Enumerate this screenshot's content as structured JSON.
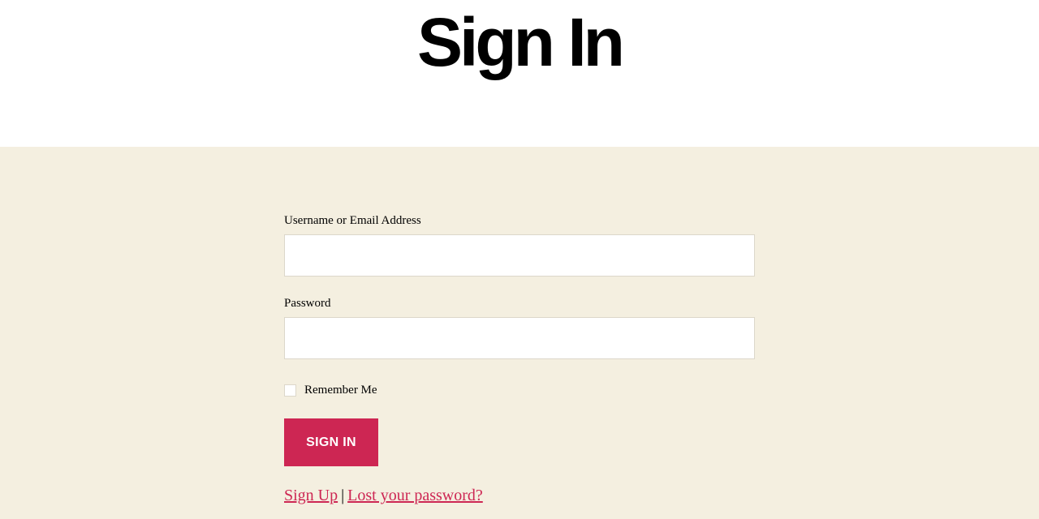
{
  "header": {
    "title": "Sign In"
  },
  "form": {
    "username_label": "Username or Email Address",
    "username_value": "",
    "password_label": "Password",
    "password_value": "",
    "remember_label": "Remember Me",
    "remember_checked": false,
    "submit_label": "SIGN IN"
  },
  "links": {
    "signup": "Sign Up",
    "separator": "|",
    "lost_password": "Lost your password?"
  },
  "colors": {
    "accent": "#cd2653",
    "content_background": "#f4efe0",
    "header_background": "#ffffff",
    "input_border": "#dcd7ca"
  }
}
